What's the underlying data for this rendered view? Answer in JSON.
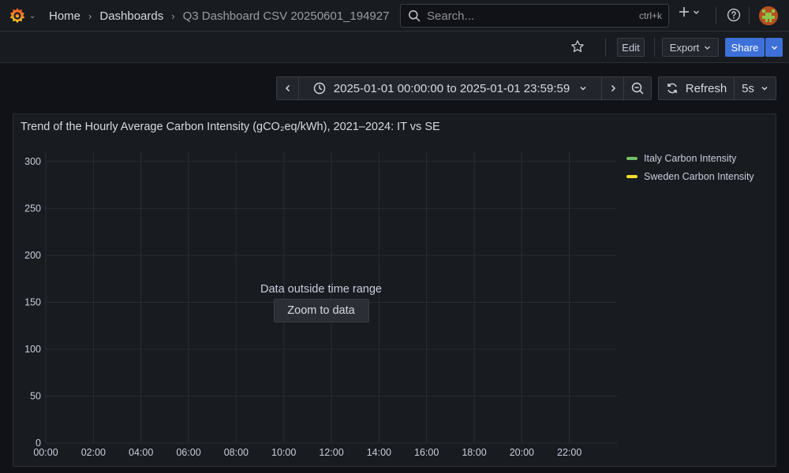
{
  "topbar": {
    "breadcrumbs": [
      "Home",
      "Dashboards",
      "Q3 Dashboard CSV 20250601_194927"
    ],
    "search": {
      "placeholder": "Search...",
      "shortcut": "ctrl+k"
    }
  },
  "toolbar": {
    "edit_label": "Edit",
    "export_label": "Export",
    "share_label": "Share"
  },
  "time_controls": {
    "range": "2025-01-01 00:00:00 to 2025-01-01 23:59:59",
    "refresh_label": "Refresh",
    "refresh_interval": "5s"
  },
  "panel": {
    "title": "Trend of the Hourly Average Carbon Intensity (gCO₂eq/kWh), 2021–2024: IT vs SE",
    "no_data_message": "Data outside time range",
    "zoom_button_label": "Zoom to data"
  },
  "chart_data": {
    "type": "line",
    "title": "Trend of the Hourly Average Carbon Intensity (gCO₂eq/kWh), 2021–2024: IT vs SE",
    "x_ticks": [
      "00:00",
      "02:00",
      "04:00",
      "06:00",
      "08:00",
      "10:00",
      "12:00",
      "14:00",
      "16:00",
      "18:00",
      "20:00",
      "22:00"
    ],
    "y_ticks": [
      0,
      50,
      100,
      150,
      200,
      250,
      300
    ],
    "xlim": [
      "2025-01-01 00:00:00",
      "2025-01-01 23:59:59"
    ],
    "ylim": [
      0,
      310
    ],
    "grid": true,
    "legend_position": "right",
    "series": [
      {
        "name": "Italy Carbon Intensity",
        "color": "#73bf69",
        "values": []
      },
      {
        "name": "Sweden Carbon Intensity",
        "color": "#fade2a",
        "values": []
      }
    ]
  },
  "colors": {
    "background": "#111217",
    "panel": "#181b1f",
    "primary": "#3d71d9"
  }
}
